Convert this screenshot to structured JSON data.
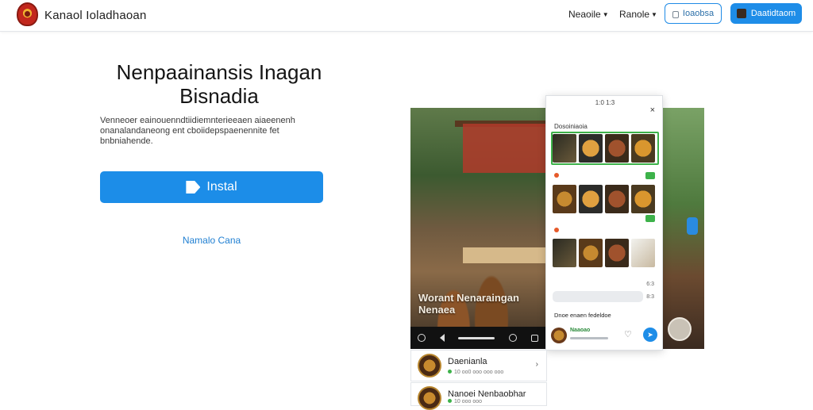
{
  "header": {
    "brand": "Kanaol Ioladhaoan",
    "nav": [
      {
        "label": "Neaoile"
      },
      {
        "label": "Ranole"
      }
    ],
    "outline_button": "Ioaobsa",
    "solid_button": "Daatidtaom"
  },
  "hero": {
    "title_line1": "Nenpaainansis Inagan",
    "title_line2": "Bisnadia",
    "desc_line1": "Venneoer eainouenndtiidiemnterieeaen aiaeenenh",
    "desc_line2": "onanalandaneong ent cboiidepspaenennite fet",
    "desc_line3": "bnbniahende.",
    "install_label": "Instal",
    "secondary_link": "Namalo Cana"
  },
  "phone": {
    "caption_line1": "Worant Nenaraingan",
    "caption_line2": "Nenaea"
  },
  "sheet": {
    "status": "1:0 1:3",
    "close": "×",
    "heading1": "Dosoiniaoia",
    "heading2": "Dnoe enaen fedeldoe",
    "meta_right1": "6:3",
    "meta_right2": "8:3",
    "bottom_name": "Naaoao",
    "fab_icon": "➤"
  },
  "list": [
    {
      "title": "Daenianla",
      "sub": "10 oo0 ooo ooo ooo"
    },
    {
      "title": "Nanoei Nenbaobhar",
      "sub": "10 ooo ooo"
    }
  ]
}
